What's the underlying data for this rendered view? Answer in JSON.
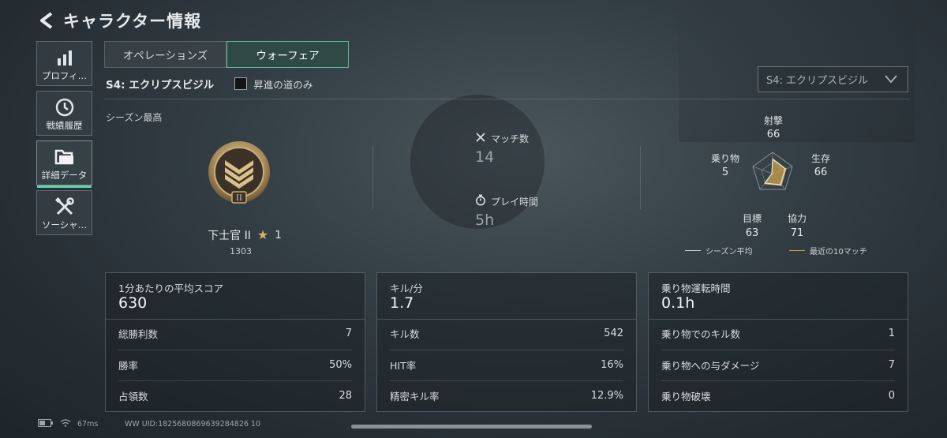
{
  "header": {
    "title": "キャラクター情報"
  },
  "sidebar": {
    "items": [
      {
        "label": "プロフィ…",
        "icon": "bar-chart-icon"
      },
      {
        "label": "戦績履歴",
        "icon": "history-clock-icon"
      },
      {
        "label": "詳細データ",
        "icon": "folder-icon",
        "active": true
      },
      {
        "label": "ソーシャ…",
        "icon": "wrench-screwdriver-icon"
      }
    ]
  },
  "tabs": [
    {
      "label": "オペレーションズ",
      "active": false
    },
    {
      "label": "ウォーフェア",
      "active": true
    }
  ],
  "season": {
    "name": "S4: エクリプスビジル",
    "checkbox_label": "昇進の道のみ",
    "checkbox_checked": false,
    "select_value": "S4: エクリプスビジル"
  },
  "best": {
    "label": "シーズン最高",
    "rank_name": "下士官 II",
    "rank_stars": "1",
    "rank_points": "1303",
    "badge_numeral": "II"
  },
  "mini_stats": {
    "matches_label": "マッチ数",
    "matches_value": "14",
    "playtime_label": "プレイ時間",
    "playtime_value": "5h"
  },
  "radar": {
    "shooting_label": "射撃",
    "shooting_value": "66",
    "survival_label": "生存",
    "survival_value": "66",
    "teamwork_label": "協力",
    "teamwork_value": "71",
    "objective_label": "目標",
    "objective_value": "63",
    "vehicle_label": "乗り物",
    "vehicle_value": "5",
    "legend_season": "シーズン平均",
    "legend_recent": "最近の10マッチ",
    "colors": {
      "season": "#c8cdd0",
      "recent": "#c9a24a"
    }
  },
  "panels": {
    "score": {
      "head": "1分あたりの平均スコア",
      "big": "630",
      "rows": [
        {
          "label": "総勝利数",
          "value": "7"
        },
        {
          "label": "勝率",
          "value": "50%"
        },
        {
          "label": "占領数",
          "value": "28"
        }
      ]
    },
    "kills": {
      "head": "キル/分",
      "big": "1.7",
      "rows": [
        {
          "label": "キル数",
          "value": "542"
        },
        {
          "label": "HIT率",
          "value": "16%"
        },
        {
          "label": "精密キル率",
          "value": "12.9%"
        }
      ]
    },
    "vehicle": {
      "head": "乗り物運転時間",
      "big": "0.1h",
      "rows": [
        {
          "label": "乗り物でのキル数",
          "value": "1"
        },
        {
          "label": "乗り物への与ダメージ",
          "value": "7"
        },
        {
          "label": "乗り物破壊",
          "value": "0"
        }
      ]
    }
  },
  "status": {
    "ping": "67ms",
    "uid": "WW UID:1825680869639284826 10"
  }
}
